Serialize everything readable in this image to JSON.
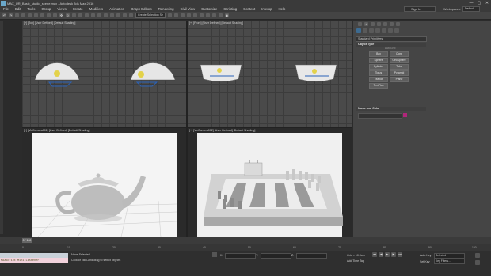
{
  "app": {
    "title": "MAX_UR_Basic_studio_scene.max - Autodesk 3ds Max 2016",
    "window_controls": [
      "—",
      "▢",
      "✕"
    ]
  },
  "menu": [
    "File",
    "Edit",
    "Tools",
    "Group",
    "Views",
    "Create",
    "Modifiers",
    "Animation",
    "Graph Editors",
    "Rendering",
    "Civil View",
    "Customize",
    "Scripting",
    "Content",
    "Interop",
    "Help"
  ],
  "header": {
    "signin_label": "Sign In",
    "workspaces_label": "Workspaces:",
    "workspaces_value": "Default"
  },
  "toolbar": {
    "selection_set_label": "Create Selection Se"
  },
  "viewports": {
    "top_left_label": "[+] [Top] [User Defined] [Default Shading]",
    "top_right_label": "[+] [Front] [User Defined] [Default Shading]",
    "bottom_left_label": "[+] [VizCamera001] [User Defined] [Default Shading]",
    "bottom_right_label": "[+] [VizCamera002] [User Defined] [Default Shading]"
  },
  "command_panel": {
    "dropdown": "Standard Primitives",
    "object_type_header": "Object Type",
    "autogrid": "AutoGrid",
    "object_types": [
      "Box",
      "Cone",
      "Sphere",
      "GeoSphere",
      "Cylinder",
      "Tube",
      "Torus",
      "Pyramid",
      "Teapot",
      "Plane",
      "TextPlus"
    ],
    "name_color_header": "Name and Color",
    "object_color": "#b0267a"
  },
  "timeline": {
    "frame_indicator": "0 / 100",
    "ticks": [
      "0",
      "10",
      "20",
      "30",
      "40",
      "50",
      "60",
      "70",
      "80",
      "90",
      "100"
    ]
  },
  "status": {
    "maxscript_text": "MAXScript Mini Listener",
    "selection_status": "None Selected",
    "prompt": "Click or click-and-drag to select objects",
    "grid": "Grid = 10.0cm",
    "add_time_tag": "Add Time Tag",
    "auto_key": "Auto Key",
    "auto_key_value": "Selected",
    "set_key": "Set Key",
    "key_filters": "Key Filters...",
    "coord_x": "X:",
    "coord_y": "Y:",
    "coord_z": "Z:"
  }
}
